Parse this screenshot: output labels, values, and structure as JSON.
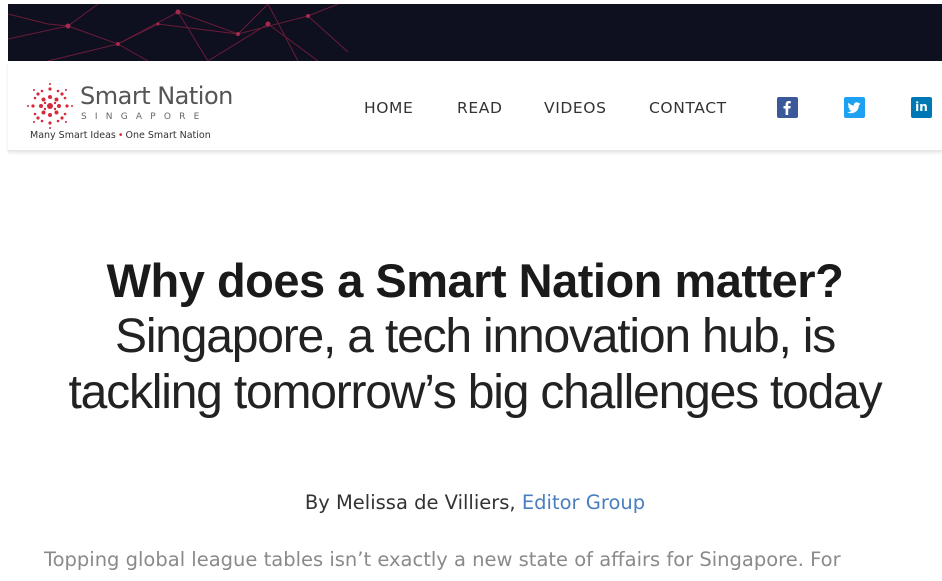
{
  "brand": {
    "title": "Smart Nation",
    "subtitle": "SINGAPORE",
    "tagline_left": "Many Smart Ideas",
    "tagline_sep": "•",
    "tagline_right": "One Smart Nation",
    "logo_icon": "dotted-circle-logo-icon",
    "accent_color": "#d62a3c"
  },
  "nav": {
    "items": [
      {
        "label": "HOME"
      },
      {
        "label": "READ"
      },
      {
        "label": "VIDEOS"
      },
      {
        "label": "CONTACT"
      }
    ],
    "social": [
      {
        "name": "facebook-icon",
        "glyph": "f",
        "color": "#3b5998"
      },
      {
        "name": "twitter-icon",
        "glyph": "t",
        "color": "#1da1f2"
      },
      {
        "name": "linkedin-icon",
        "glyph": "in",
        "color": "#0077b5"
      }
    ]
  },
  "article": {
    "headline": "Why does a Smart Nation matter?",
    "subheadline": "Singapore, a tech innovation hub, is tackling tomorrow’s big challenges today",
    "byline_prefix": "By Melissa de Villiers,",
    "byline_link": "Editor Group",
    "byline_link_color": "#4a7fbf",
    "body_first_line": "Topping global league tables isn’t exactly a new state of affairs for Singapore. For"
  },
  "colors": {
    "banner_bg": "#0e0f1f",
    "banner_lines": "#7a1f3d"
  }
}
